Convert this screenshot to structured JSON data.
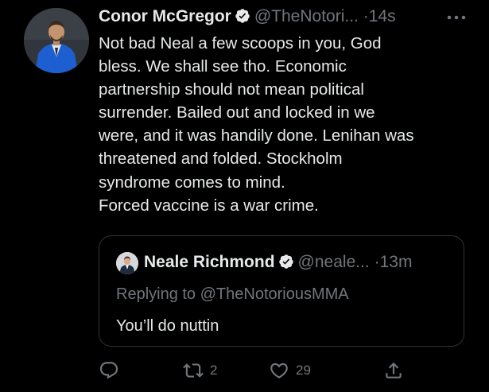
{
  "tweet": {
    "author": {
      "display_name": "Conor McGregor",
      "handle": "@TheNotori...",
      "verified": true,
      "avatar_icon": "profile-photo-man-blue-suit"
    },
    "separator": "·",
    "time": "14s",
    "more_icon": "ellipsis-icon",
    "text_lines": [
      "Not bad Neal a few scoops in you, God",
      "bless. We shall see tho. Economic",
      "partnership should not mean political",
      "surrender. Bailed out and locked in we",
      "were, and it was handily done. Lenihan was",
      "threatened and folded. Stockholm",
      "syndrome comes to mind.",
      "Forced vaccine is a war crime."
    ],
    "quoted_tweet": {
      "author": {
        "display_name": "Neale Richmond",
        "handle": "@neale...",
        "verified": true,
        "avatar_icon": "profile-photo-man-suit"
      },
      "separator": "·",
      "time": "13m",
      "replying_to": "Replying to @TheNotoriousMMA",
      "text": "You’ll do nuttin"
    },
    "actions": {
      "reply": {
        "icon": "reply-icon",
        "count": ""
      },
      "retweet": {
        "icon": "retweet-icon",
        "count": "2"
      },
      "like": {
        "icon": "heart-icon",
        "count": "29"
      },
      "share": {
        "icon": "share-icon",
        "count": ""
      }
    }
  },
  "colors": {
    "background": "#000000",
    "primary_text": "#e7e9ea",
    "secondary_text": "#71767b",
    "border": "#2f3336",
    "verified_badge": "#e7e9ea"
  }
}
